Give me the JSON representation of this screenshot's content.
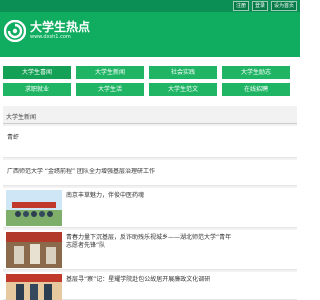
{
  "topbar": {
    "links": [
      "注册",
      "登录",
      "设为首页"
    ]
  },
  "header": {
    "logo_title": "大学生热点",
    "logo_subtitle": "www.dxsh1.com",
    "logo_icon": "spiral-logo-icon"
  },
  "nav": {
    "items": [
      {
        "label": "大学生喜闻"
      },
      {
        "label": "大学生新闻"
      },
      {
        "label": "社会实践"
      },
      {
        "label": "大学生励志"
      },
      {
        "label": "求职就业"
      },
      {
        "label": "大学生活"
      },
      {
        "label": "大学生范文"
      },
      {
        "label": "在线招聘"
      }
    ]
  },
  "news": {
    "title": "大学生新闻",
    "text_items": [
      {
        "title": "青虾"
      },
      {
        "title": "广西师范大学 “金绣前程” 团队全力增强基层治理研工作"
      }
    ],
    "image_items": [
      {
        "title": "南京丰草魅力，伴俊中医药魂"
      },
      {
        "title": "青春力量下沉基层，反诈助残乐视城乡——湖北师范大学“青年志愿者先锋”队"
      },
      {
        "title": "基层寻“察”记：星耀学院赴包公故居开展廉政文化调研"
      }
    ]
  },
  "colors": {
    "brand_green": "#10ac60",
    "topbar_green": "#0b8f55",
    "nav_green": "#1fb564"
  }
}
